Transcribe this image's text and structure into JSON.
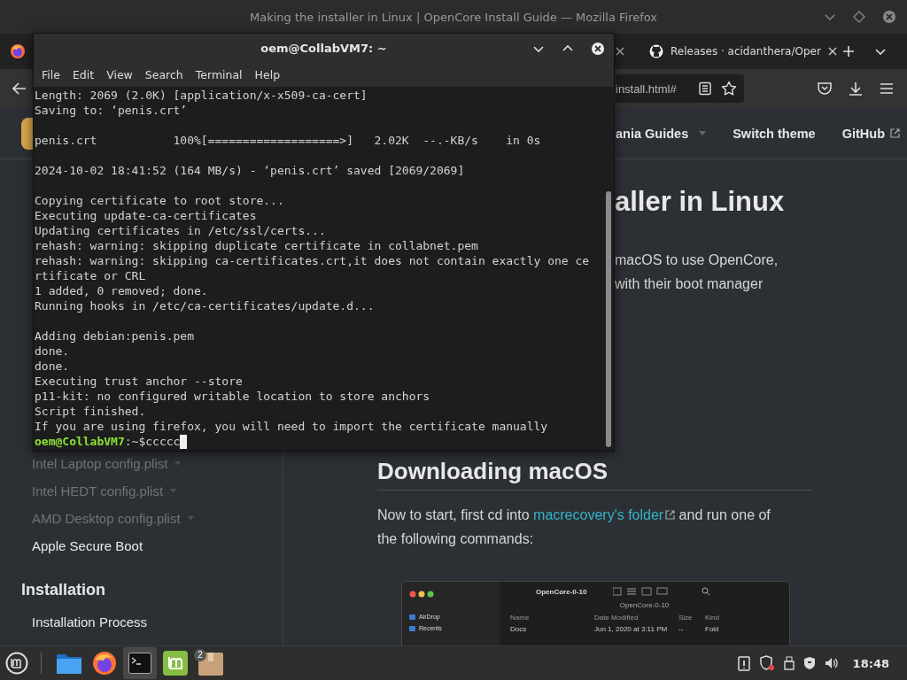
{
  "browser": {
    "title": "Making the installer in Linux | OpenCore Install Guide — Mozilla Firefox",
    "tabs": [
      {
        "title": "Releases · acidanthera/Oper",
        "selected": false
      }
    ],
    "url": "install.html#"
  },
  "page": {
    "nav_links": [
      {
        "label": "ania Guides",
        "dropdown": true,
        "external": false
      },
      {
        "label": "Switch theme",
        "dropdown": false,
        "external": false
      },
      {
        "label": "GitHub",
        "dropdown": false,
        "external": true
      }
    ],
    "sidebar": [
      {
        "kind": "link",
        "label": "Intel Laptop config.plist",
        "dimmed": true,
        "expandable": true
      },
      {
        "kind": "link",
        "label": "Intel HEDT config.plist",
        "dimmed": true,
        "expandable": true
      },
      {
        "kind": "link",
        "label": "AMD Desktop config.plist",
        "dimmed": true,
        "expandable": true
      },
      {
        "kind": "link",
        "label": "Apple Secure Boot",
        "dimmed": false,
        "expandable": false
      },
      {
        "kind": "heading",
        "label": "Installation"
      },
      {
        "kind": "link",
        "label": "Installation Process",
        "dimmed": false,
        "expandable": false
      }
    ],
    "heading_fragment": "aller in Linux",
    "intro_lines": [
      "macOS to use OpenCore,",
      "with their boot manager"
    ],
    "section_title": "Downloading macOS",
    "paragraph": {
      "before": "Now to start, first cd into",
      "link": "macrecovery's folder",
      "after": "and run one of the following commands:"
    },
    "figure": {
      "title": "OpenCore-0-10",
      "path": "OpenCore-0-10",
      "sidebar_items": [
        "AirDrop",
        "Recents"
      ],
      "columns": [
        "Name",
        "Date Modified",
        "Size",
        "Kind"
      ],
      "row": [
        "Docs",
        "Jun 1, 2020 at 3:11 PM",
        "--",
        "Fold"
      ]
    }
  },
  "terminal": {
    "title": "oem@CollabVM7: ~",
    "menu": [
      "File",
      "Edit",
      "View",
      "Search",
      "Terminal",
      "Help"
    ],
    "blocks": [
      [
        "Length: 2069 (2.0K) [application/x-x509-ca-cert]",
        "Saving to: ‘penis.crt’"
      ],
      [
        "penis.crt           100%[===================>]   2.02K  --.-KB/s    in 0s"
      ],
      [
        "2024-10-02 18:41:52 (164 MB/s) - ‘penis.crt’ saved [2069/2069]"
      ],
      [
        "Copying certificate to root store...",
        "Executing update-ca-certificates",
        "Updating certificates in /etc/ssl/certs...",
        "rehash: warning: skipping duplicate certificate in collabnet.pem",
        "rehash: warning: skipping ca-certificates.crt,it does not contain exactly one ce",
        "rtificate or CRL",
        "1 added, 0 removed; done.",
        "Running hooks in /etc/ca-certificates/update.d..."
      ],
      [
        "Adding debian:penis.pem",
        "done.",
        "done.",
        "Executing trust anchor --store",
        "p11-kit: no configured writable location to store anchors",
        "Script finished.",
        "If you are using firefox, you will need to import the certificate manually"
      ]
    ],
    "prompt": {
      "user": "oem@CollabVM7",
      "path": ":~$",
      "command": "ccccc"
    }
  },
  "taskbar": {
    "apps": [
      {
        "kind": "files",
        "active": false
      },
      {
        "kind": "firefox",
        "active": false
      },
      {
        "kind": "terminal",
        "active": true
      },
      {
        "kind": "update",
        "active": false
      },
      {
        "kind": "package",
        "active": false,
        "badge": "2"
      }
    ],
    "clock": "18:48"
  }
}
